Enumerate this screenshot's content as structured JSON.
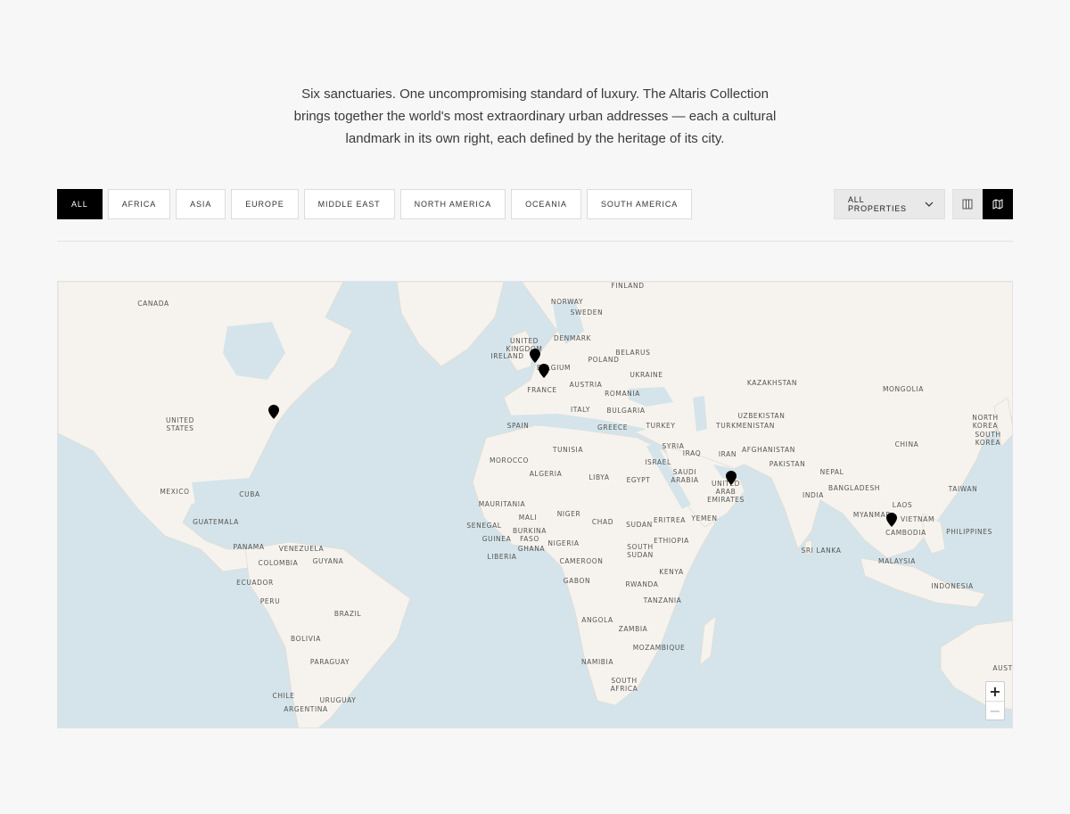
{
  "intro": {
    "line1": "Six sanctuaries. One uncompromising standard of luxury. The Altaris Collection",
    "line2": "brings together the world's most extraordinary urban addresses — each a cultural",
    "line3": "landmark in its own right, each defined by the heritage of its city."
  },
  "filters": {
    "regions": [
      {
        "label": "ALL",
        "active": true
      },
      {
        "label": "AFRICA",
        "active": false
      },
      {
        "label": "ASIA",
        "active": false
      },
      {
        "label": "EUROPE",
        "active": false
      },
      {
        "label": "MIDDLE EAST",
        "active": false
      },
      {
        "label": "NORTH AMERICA",
        "active": false
      },
      {
        "label": "OCEANIA",
        "active": false
      },
      {
        "label": "SOUTH AMERICA",
        "active": false
      }
    ],
    "property_select": "ALL PROPERTIES",
    "active_view": "map"
  },
  "icons": {
    "dropdown": "chevron-down-icon",
    "grid_view": "columns-icon",
    "map_view": "map-icon",
    "marker": "map-pin-icon"
  },
  "colors": {
    "accent": "#000000",
    "water": "#d4e4ea",
    "land": "#f6f3ee"
  },
  "map": {
    "labels": {
      "canada": "CANADA",
      "usa": "UNITED\nSTATES",
      "mexico": "MEXICO",
      "cuba": "CUBA",
      "guatemala": "GUATEMALA",
      "panama": "PANAMA",
      "venezuela": "VENEZUELA",
      "guyana": "GUYANA",
      "colombia": "COLOMBIA",
      "ecuador": "ECUADOR",
      "peru": "PERU",
      "brazil": "BRAZIL",
      "bolivia": "BOLIVIA",
      "paraguay": "PARAGUAY",
      "chile": "CHILE",
      "uruguay": "URUGUAY",
      "argentina": "ARGENTINA",
      "finland": "FINLAND",
      "norway": "NORWAY",
      "sweden": "SWEDEN",
      "denmark": "DENMARK",
      "uk": "UNITED\nKINGDOM",
      "ireland": "IRELAND",
      "belgium": "BELGIUM",
      "belarus": "BELARUS",
      "poland": "POLAND",
      "ukraine": "UKRAINE",
      "france": "FRANCE",
      "austria": "AUSTRIA",
      "romania": "ROMANIA",
      "italy": "ITALY",
      "bulgaria": "BULGARIA",
      "spain": "SPAIN",
      "greece": "GREECE",
      "turkey": "TURKEY",
      "kazakhstan": "KAZAKHSTAN",
      "mongolia": "MONGOLIA",
      "uzbekistan": "UZBEKISTAN",
      "turkmenistan": "TURKMENISTAN",
      "north_korea": "NORTH\nKOREA",
      "south_korea": "SOUTH\nKOREA",
      "china": "CHINA",
      "afghanistan": "AFGHANISTAN",
      "pakistan": "PAKISTAN",
      "syria": "SYRIA",
      "iraq": "IRAQ",
      "iran": "IRAN",
      "israel": "ISRAEL",
      "tunisia": "TUNISIA",
      "morocco": "MOROCCO",
      "algeria": "ALGERIA",
      "libya": "LIBYA",
      "egypt": "EGYPT",
      "saudi": "SAUDI\nARABIA",
      "uae": "UNITED\nARAB\nEMIRATES",
      "nepal": "NEPAL",
      "bangladesh": "BANGLADESH",
      "india": "INDIA",
      "taiwan": "TAIWAN",
      "mauritania": "MAURITANIA",
      "mali": "MALI",
      "niger": "NIGER",
      "chad": "CHAD",
      "sudan": "SUDAN",
      "eritrea": "ERITREA",
      "yemen": "YEMEN",
      "myanmar": "MYANMAR",
      "laos": "LAOS",
      "vietnam": "VIETNAM",
      "senegal": "SENEGAL",
      "guinea": "GUINEA",
      "burkina": "BURKINA\nFASO",
      "nigeria": "NIGERIA",
      "ethiopia": "ETHIOPIA",
      "ghana": "GHANA",
      "south_sudan": "SOUTH\nSUDAN",
      "cambodia": "CAMBODIA",
      "philippines": "PHILIPPINES",
      "liberia": "LIBERIA",
      "cameroon": "CAMEROON",
      "sri_lanka": "SRI LANKA",
      "kenya": "KENYA",
      "malaysia": "MALAYSIA",
      "gabon": "GABON",
      "rwanda": "RWANDA",
      "indonesia": "INDONESIA",
      "tanzania": "TANZANIA",
      "angola": "ANGOLA",
      "zambia": "ZAMBIA",
      "mozambique": "MOZAMBIQUE",
      "namibia": "NAMIBIA",
      "australia": "AUSTI",
      "south_africa": "SOUTH\nAFRICA"
    },
    "zoom_in": "+",
    "zoom_out": "−"
  }
}
